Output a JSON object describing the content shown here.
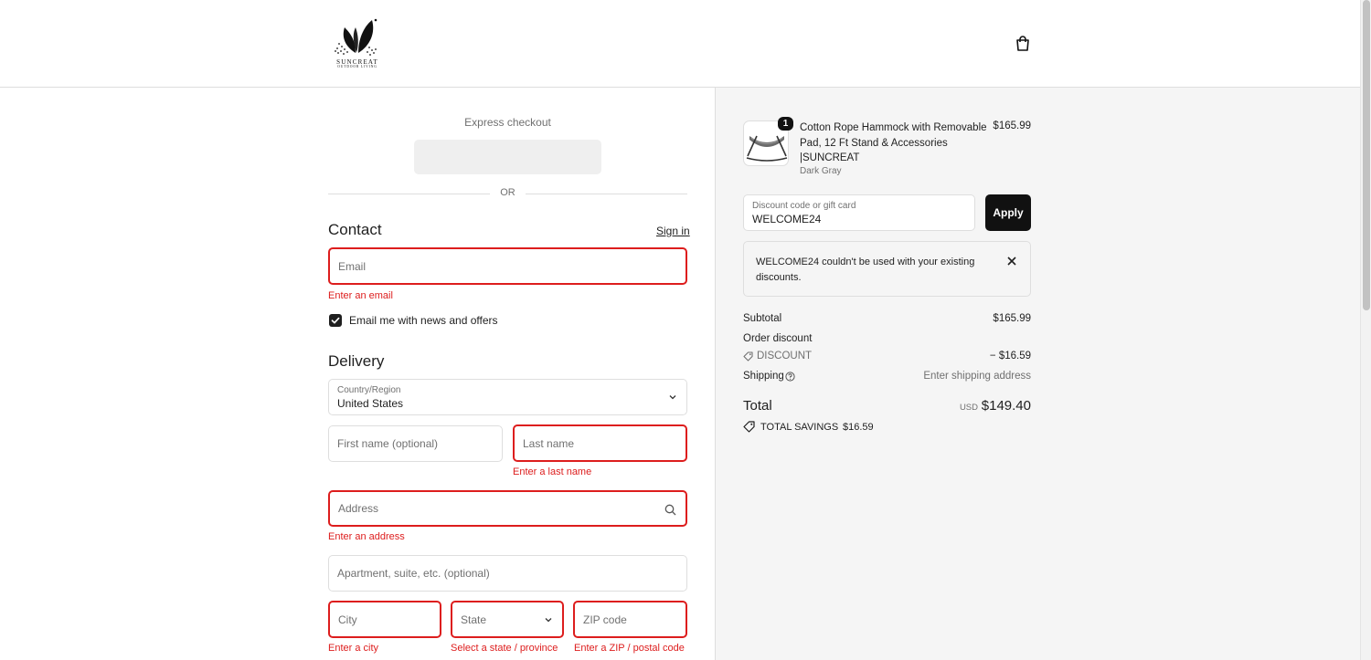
{
  "brand": {
    "name": "SUNCREAT",
    "tagline": "OUTDOOR LIVING"
  },
  "checkout": {
    "express_label": "Express checkout",
    "or_label": "OR"
  },
  "contact": {
    "title": "Contact",
    "sign_in": "Sign in",
    "email_placeholder": "Email",
    "email_error": "Enter an email",
    "newsletter_label": "Email me with news and offers",
    "newsletter_checked": true
  },
  "delivery": {
    "title": "Delivery",
    "country_label": "Country/Region",
    "country_value": "United States",
    "first_name_placeholder": "First name (optional)",
    "last_name_placeholder": "Last name",
    "last_name_error": "Enter a last name",
    "address_placeholder": "Address",
    "address_error": "Enter an address",
    "apartment_placeholder": "Apartment, suite, etc. (optional)",
    "city_placeholder": "City",
    "city_error": "Enter a city",
    "state_placeholder": "State",
    "state_error": "Select a state / province",
    "zip_placeholder": "ZIP code",
    "zip_error": "Enter a ZIP / postal code"
  },
  "summary": {
    "product": {
      "title": "Cotton Rope Hammock with Removable Pad, 12 Ft Stand & Accessories |SUNCREAT",
      "variant": "Dark Gray",
      "price": "$165.99",
      "quantity": "1"
    },
    "discount": {
      "label": "Discount code or gift card",
      "value": "WELCOME24",
      "apply_label": "Apply",
      "notice": "WELCOME24 couldn't be used with your existing discounts."
    },
    "subtotal_label": "Subtotal",
    "subtotal_value": "$165.99",
    "order_discount_label": "Order discount",
    "discount_tag": "DISCOUNT",
    "discount_value": "− $16.59",
    "shipping_label": "Shipping",
    "shipping_value": "Enter shipping address",
    "total_label": "Total",
    "currency": "USD",
    "total_value": "$149.40",
    "savings_label": "TOTAL SAVINGS",
    "savings_value": "$16.59"
  },
  "colors": {
    "error": "#dd1d1d",
    "button": "#111111",
    "panel": "#f5f5f5"
  }
}
